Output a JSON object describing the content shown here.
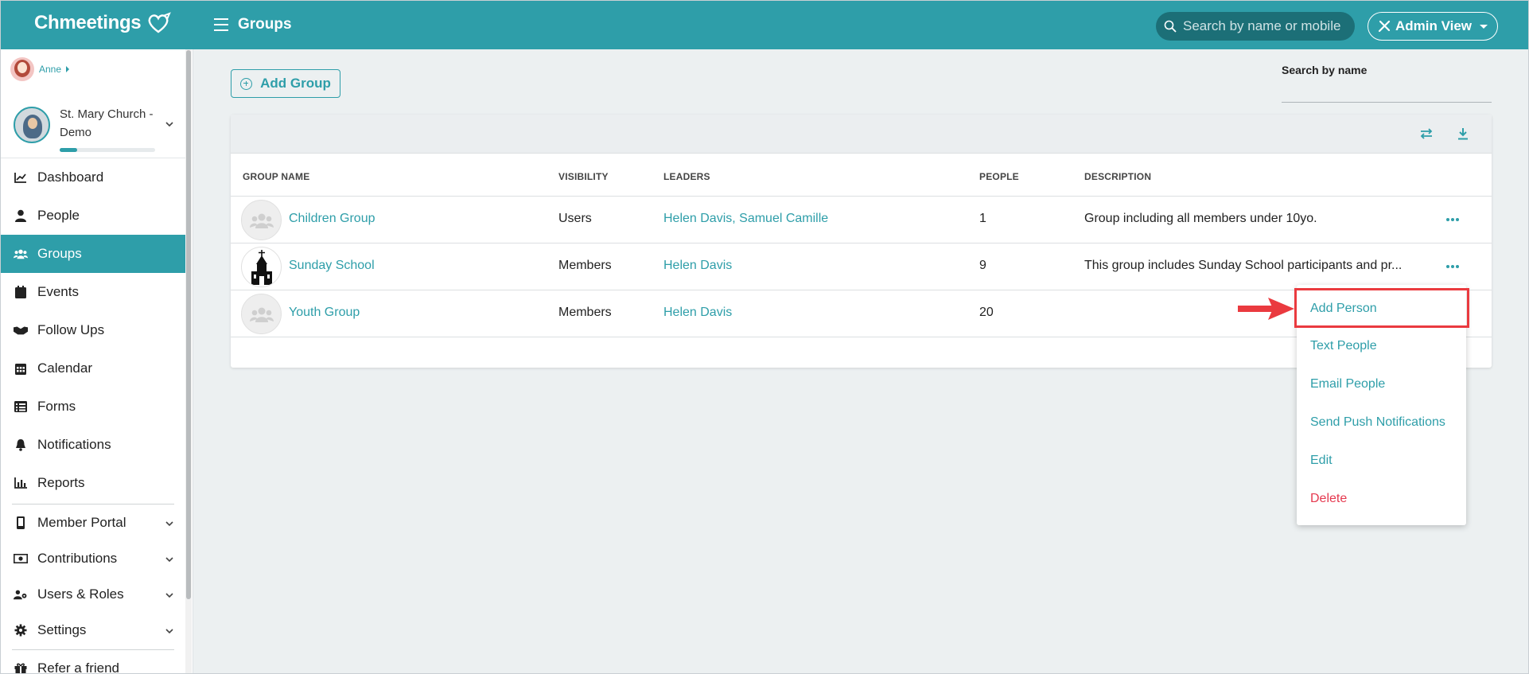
{
  "app": {
    "brand": "Chmeetings",
    "page_title": "Groups",
    "search_placeholder": "Search by name or mobile",
    "admin_view_label": "Admin View",
    "accent_color": "#2e9ea9"
  },
  "user": {
    "name": "Anne",
    "church_name": "St. Mary Church - Demo",
    "setup_progress_fraction": 0.18
  },
  "sidebar": {
    "items": [
      {
        "label": "Dashboard",
        "icon": "chart-line-icon"
      },
      {
        "label": "People",
        "icon": "person-icon"
      },
      {
        "label": "Groups",
        "icon": "users-icon",
        "active": true
      },
      {
        "label": "Events",
        "icon": "calendar-icon"
      },
      {
        "label": "Follow Ups",
        "icon": "handshake-icon"
      },
      {
        "label": "Calendar",
        "icon": "calendar-grid-icon"
      },
      {
        "label": "Forms",
        "icon": "list-icon"
      },
      {
        "label": "Notifications",
        "icon": "bell-icon"
      },
      {
        "label": "Reports",
        "icon": "bar-chart-icon"
      },
      {
        "label": "Member Portal",
        "icon": "mobile-icon",
        "expandable": true
      },
      {
        "label": "Contributions",
        "icon": "money-icon",
        "expandable": true
      },
      {
        "label": "Users & Roles",
        "icon": "users-cog-icon",
        "expandable": true
      },
      {
        "label": "Settings",
        "icon": "gear-icon",
        "expandable": true
      },
      {
        "label": "Refer a friend",
        "icon": "gift-icon"
      }
    ]
  },
  "main": {
    "add_group_label": "Add Group",
    "search_label": "Search by name",
    "search_value": "",
    "table": {
      "columns": [
        "GROUP NAME",
        "VISIBILITY",
        "LEADERS",
        "PEOPLE",
        "DESCRIPTION"
      ],
      "rows": [
        {
          "name": "Children Group",
          "visibility": "Users",
          "leaders": "Helen Davis, Samuel Camille",
          "people": "1",
          "description": "Group including all members under 10yo."
        },
        {
          "name": "Sunday School",
          "visibility": "Members",
          "leaders": "Helen Davis",
          "people": "9",
          "description": "This group includes Sunday School participants and pr..."
        },
        {
          "name": "Youth Group",
          "visibility": "Members",
          "leaders": "Helen Davis",
          "people": "20",
          "description": ""
        }
      ]
    },
    "row_menu": {
      "items": [
        "Add Person",
        "Text People",
        "Email People",
        "Send Push Notifications",
        "Edit",
        "Delete"
      ],
      "highlighted": "Add Person"
    }
  }
}
